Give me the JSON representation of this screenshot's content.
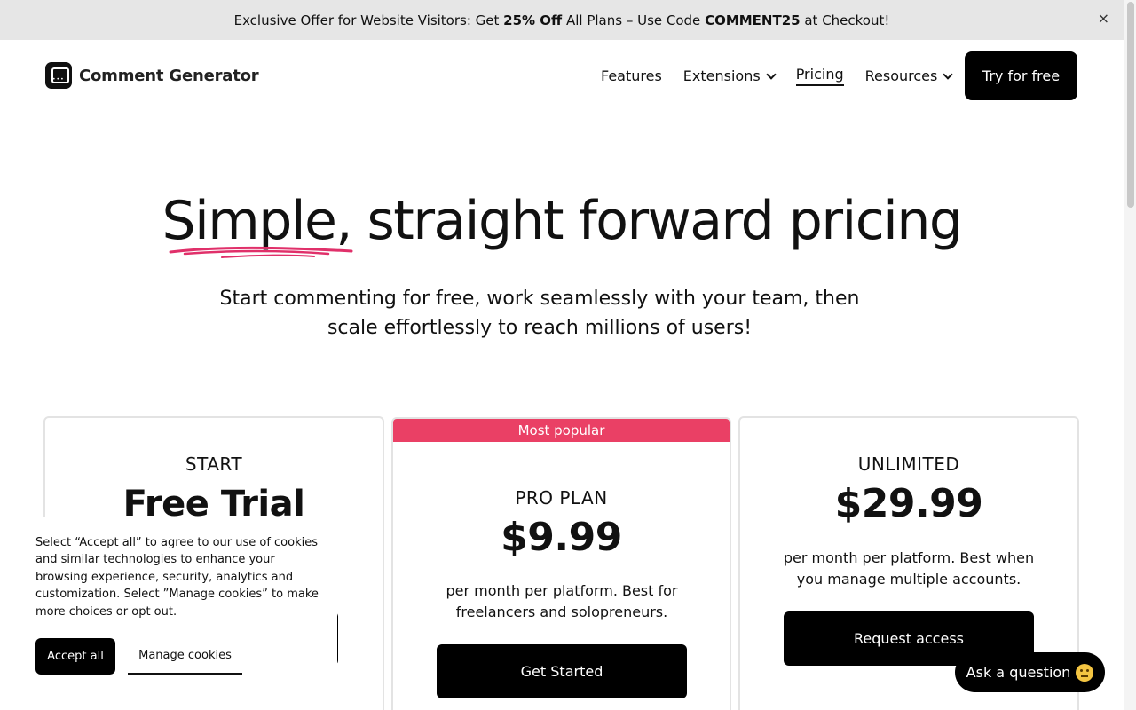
{
  "announcement": {
    "prefix": "Exclusive Offer for Website Visitors: Get ",
    "discount": "25% Off",
    "middle": " All Plans – Use Code ",
    "code": "COMMENT25",
    "suffix": " at Checkout!",
    "close_icon": "×"
  },
  "brand": {
    "name": "Comment Generator",
    "logo_icon": "comment-generator-logo-icon"
  },
  "nav": {
    "items": [
      {
        "label": "Features",
        "has_dropdown": false,
        "active": false
      },
      {
        "label": "Extensions",
        "has_dropdown": true,
        "active": false
      },
      {
        "label": "Pricing",
        "has_dropdown": false,
        "active": true
      },
      {
        "label": "Resources",
        "has_dropdown": true,
        "active": false
      }
    ],
    "cta_label": "Try for free"
  },
  "hero": {
    "title_highlight": "Simple",
    "title_rest": ", straight forward pricing",
    "subtitle_line1": "Start commenting for free, work seamlessly with your team, then",
    "subtitle_line2": "scale effortlessly to reach millions of users!",
    "accent_color": "#e0306a"
  },
  "plans": [
    {
      "name": "START",
      "price": "Free Trial",
      "description": "",
      "cta": "",
      "badge": ""
    },
    {
      "name": "PRO PLAN",
      "price": "$9.99",
      "description": "per month per platform. Best for freelancers and solopreneurs.",
      "cta": "Get Started",
      "badge": "Most popular"
    },
    {
      "name": "UNLIMITED",
      "price": "$29.99",
      "description": "per month per platform. Best when you manage multiple accounts.",
      "cta": "Request access",
      "badge": ""
    }
  ],
  "cookie_banner": {
    "text": "Select “Accept all” to agree to our use of cookies and similar technologies to enhance your browsing experience, security, analytics and customization. Select ”Manage cookies” to make more choices or opt out.",
    "accept_label": "Accept all",
    "manage_label": "Manage cookies"
  },
  "chat": {
    "label": "Ask a question",
    "emoji_icon": "thinking-face-icon"
  },
  "colors": {
    "badge": "#ea4065",
    "button": "#000000",
    "announcement_bg": "#e6e6e6"
  }
}
